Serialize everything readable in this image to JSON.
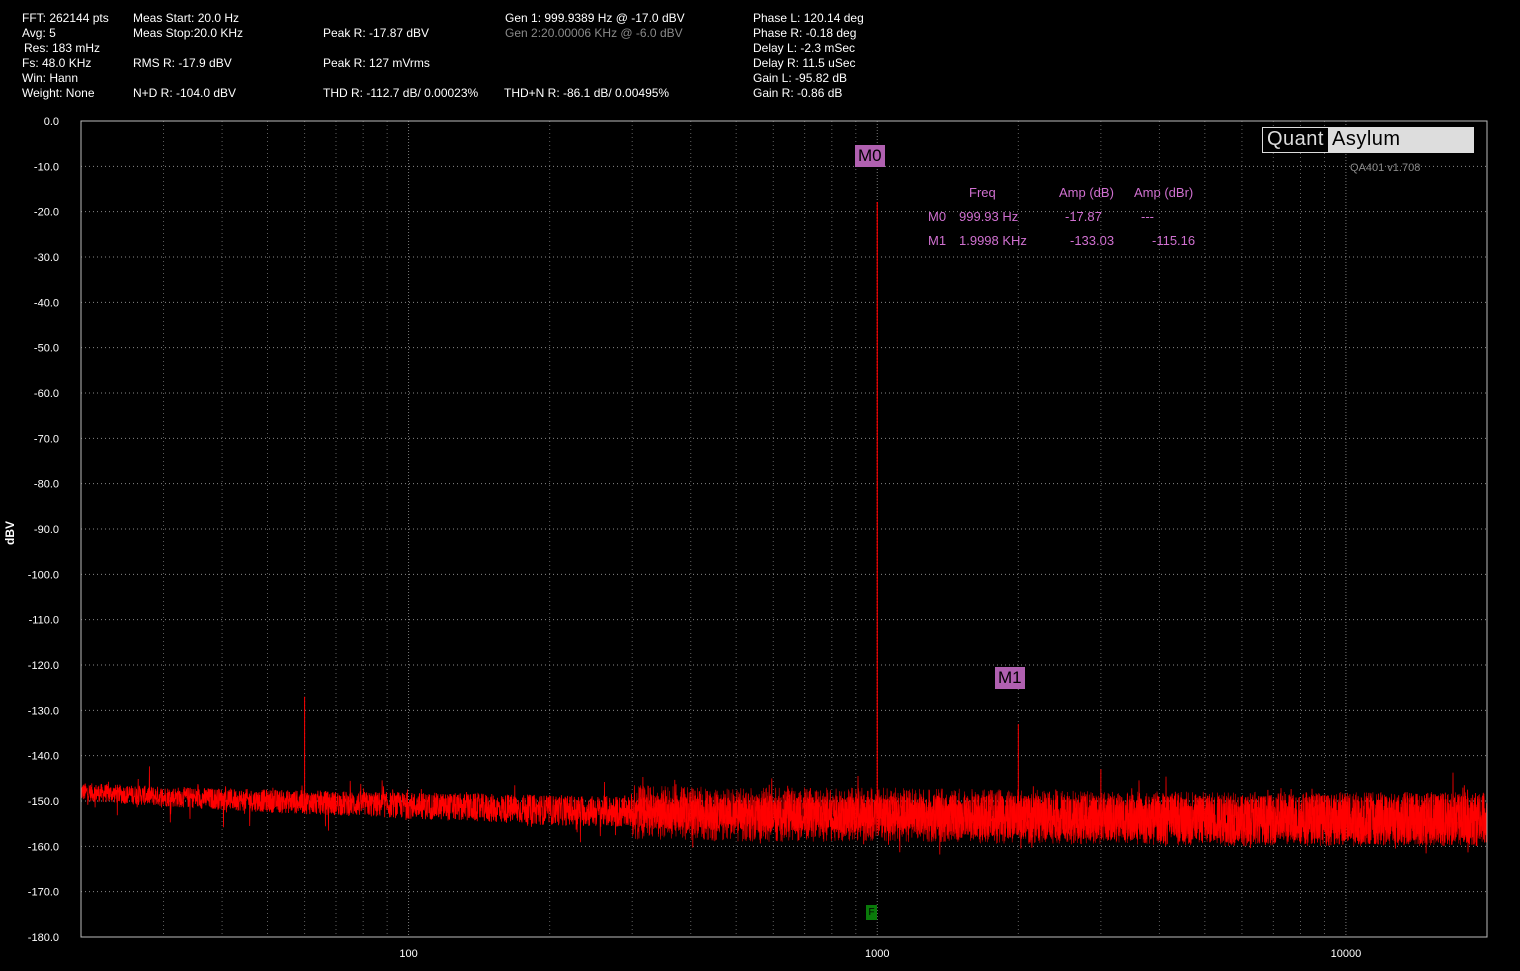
{
  "header": {
    "col1": [
      "FFT: 262144 pts",
      "Avg: 5",
      "Res: 183 mHz",
      "Fs: 48.0 KHz",
      "Win: Hann",
      "Weight: None"
    ],
    "meas_start": "Meas Start: 20.0 Hz",
    "meas_stop": "Meas Stop:20.0 KHz",
    "rms_r": "RMS R: -17.9 dBV",
    "nd_r": "N+D R: -104.0 dBV",
    "peak_r_dbv": "Peak R: -17.87 dBV",
    "peak_r_mvrms": "Peak R: 127 mVrms",
    "thd_r": "THD R: -112.7 dB/ 0.00023%",
    "gen1": "Gen 1: 999.9389 Hz @ -17.0  dBV",
    "gen2": "Gen 2:20.00006 KHz @ -6.0  dBV",
    "thdn_r": "THD+N R: -86.1 dB/ 0.00495%",
    "col5": [
      "Phase L: 120.14 deg",
      "Phase R: -0.18 deg",
      "Delay L: -2.3 mSec",
      "Delay R: 11.5 uSec",
      "Gain L: -95.82 dB",
      "Gain R: -0.86 dB"
    ]
  },
  "logo": {
    "left": "Quant",
    "right": "Asylum"
  },
  "version": "QA401 v1.708",
  "markers": {
    "col_freq": "Freq",
    "col_amp_db": "Amp (dB)",
    "col_amp_dbr": "Amp (dBr)",
    "rows": [
      {
        "id": "M0",
        "freq": "999.93 Hz",
        "amp_db": "-17.87",
        "amp_dbr": "---"
      },
      {
        "id": "M1",
        "freq": "1.9998 KHz",
        "amp_db": "-133.03",
        "amp_dbr": "-115.16"
      }
    ]
  },
  "ftag": "F",
  "colors": {
    "trace": "#ff0000",
    "marker": "#b060b0",
    "marker_text": "#d070d0",
    "grid": "#888888",
    "ftag": "#0a7a0a"
  },
  "chart_data": {
    "type": "line",
    "xscale": "log",
    "xlim": [
      20,
      20000
    ],
    "ylim": [
      -180,
      0
    ],
    "ylabel": "dBV",
    "xticks": [
      100,
      1000,
      10000
    ],
    "xtick_labels": [
      "100",
      "1000",
      "10000"
    ],
    "yticks": [
      0,
      -10,
      -20,
      -30,
      -40,
      -50,
      -60,
      -70,
      -80,
      -90,
      -100,
      -110,
      -120,
      -130,
      -140,
      -150,
      -160,
      -170,
      -180
    ],
    "ytick_labels": [
      "0.0",
      "-10.0",
      "-20.0",
      "-30.0",
      "-40.0",
      "-50.0",
      "-60.0",
      "-70.0",
      "-80.0",
      "-90.0",
      "-100.0",
      "-110.0",
      "-120.0",
      "-130.0",
      "-140.0",
      "-150.0",
      "-160.0",
      "-170.0",
      "-180.0"
    ],
    "grid": true,
    "noise_floor": {
      "x": [
        20,
        30,
        50,
        100,
        200,
        500,
        1000,
        2000,
        5000,
        10000,
        20000
      ],
      "y": [
        -148,
        -149,
        -150,
        -151,
        -152,
        -153,
        -153,
        -153.5,
        -154,
        -154,
        -154
      ]
    },
    "peaks": [
      {
        "x": 60,
        "y": -127
      },
      {
        "x": 999.93,
        "y": -17.87
      },
      {
        "x": 1999.8,
        "y": -133.03
      },
      {
        "x": 3000,
        "y": -143
      }
    ],
    "marker_points": [
      {
        "name": "M0",
        "x": 999.93,
        "y": -17.87
      },
      {
        "name": "M1",
        "x": 1999.8,
        "y": -133.03
      }
    ]
  }
}
